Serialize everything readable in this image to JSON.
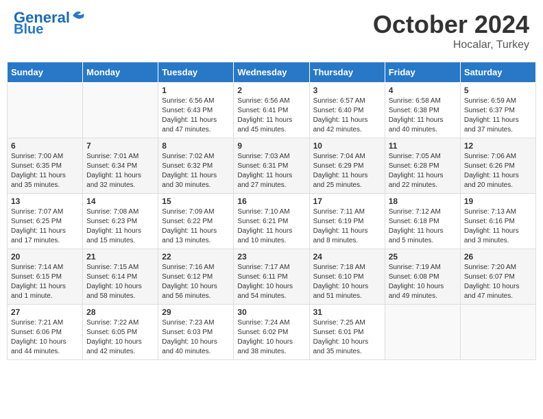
{
  "header": {
    "logo_line1": "General",
    "logo_line2": "Blue",
    "month": "October 2024",
    "location": "Hocalar, Turkey"
  },
  "days_of_week": [
    "Sunday",
    "Monday",
    "Tuesday",
    "Wednesday",
    "Thursday",
    "Friday",
    "Saturday"
  ],
  "weeks": [
    [
      {
        "day": "",
        "info": ""
      },
      {
        "day": "",
        "info": ""
      },
      {
        "day": "1",
        "info": "Sunrise: 6:56 AM\nSunset: 6:43 PM\nDaylight: 11 hours and 47 minutes."
      },
      {
        "day": "2",
        "info": "Sunrise: 6:56 AM\nSunset: 6:41 PM\nDaylight: 11 hours and 45 minutes."
      },
      {
        "day": "3",
        "info": "Sunrise: 6:57 AM\nSunset: 6:40 PM\nDaylight: 11 hours and 42 minutes."
      },
      {
        "day": "4",
        "info": "Sunrise: 6:58 AM\nSunset: 6:38 PM\nDaylight: 11 hours and 40 minutes."
      },
      {
        "day": "5",
        "info": "Sunrise: 6:59 AM\nSunset: 6:37 PM\nDaylight: 11 hours and 37 minutes."
      }
    ],
    [
      {
        "day": "6",
        "info": "Sunrise: 7:00 AM\nSunset: 6:35 PM\nDaylight: 11 hours and 35 minutes."
      },
      {
        "day": "7",
        "info": "Sunrise: 7:01 AM\nSunset: 6:34 PM\nDaylight: 11 hours and 32 minutes."
      },
      {
        "day": "8",
        "info": "Sunrise: 7:02 AM\nSunset: 6:32 PM\nDaylight: 11 hours and 30 minutes."
      },
      {
        "day": "9",
        "info": "Sunrise: 7:03 AM\nSunset: 6:31 PM\nDaylight: 11 hours and 27 minutes."
      },
      {
        "day": "10",
        "info": "Sunrise: 7:04 AM\nSunset: 6:29 PM\nDaylight: 11 hours and 25 minutes."
      },
      {
        "day": "11",
        "info": "Sunrise: 7:05 AM\nSunset: 6:28 PM\nDaylight: 11 hours and 22 minutes."
      },
      {
        "day": "12",
        "info": "Sunrise: 7:06 AM\nSunset: 6:26 PM\nDaylight: 11 hours and 20 minutes."
      }
    ],
    [
      {
        "day": "13",
        "info": "Sunrise: 7:07 AM\nSunset: 6:25 PM\nDaylight: 11 hours and 17 minutes."
      },
      {
        "day": "14",
        "info": "Sunrise: 7:08 AM\nSunset: 6:23 PM\nDaylight: 11 hours and 15 minutes."
      },
      {
        "day": "15",
        "info": "Sunrise: 7:09 AM\nSunset: 6:22 PM\nDaylight: 11 hours and 13 minutes."
      },
      {
        "day": "16",
        "info": "Sunrise: 7:10 AM\nSunset: 6:21 PM\nDaylight: 11 hours and 10 minutes."
      },
      {
        "day": "17",
        "info": "Sunrise: 7:11 AM\nSunset: 6:19 PM\nDaylight: 11 hours and 8 minutes."
      },
      {
        "day": "18",
        "info": "Sunrise: 7:12 AM\nSunset: 6:18 PM\nDaylight: 11 hours and 5 minutes."
      },
      {
        "day": "19",
        "info": "Sunrise: 7:13 AM\nSunset: 6:16 PM\nDaylight: 11 hours and 3 minutes."
      }
    ],
    [
      {
        "day": "20",
        "info": "Sunrise: 7:14 AM\nSunset: 6:15 PM\nDaylight: 11 hours and 1 minute."
      },
      {
        "day": "21",
        "info": "Sunrise: 7:15 AM\nSunset: 6:14 PM\nDaylight: 10 hours and 58 minutes."
      },
      {
        "day": "22",
        "info": "Sunrise: 7:16 AM\nSunset: 6:12 PM\nDaylight: 10 hours and 56 minutes."
      },
      {
        "day": "23",
        "info": "Sunrise: 7:17 AM\nSunset: 6:11 PM\nDaylight: 10 hours and 54 minutes."
      },
      {
        "day": "24",
        "info": "Sunrise: 7:18 AM\nSunset: 6:10 PM\nDaylight: 10 hours and 51 minutes."
      },
      {
        "day": "25",
        "info": "Sunrise: 7:19 AM\nSunset: 6:08 PM\nDaylight: 10 hours and 49 minutes."
      },
      {
        "day": "26",
        "info": "Sunrise: 7:20 AM\nSunset: 6:07 PM\nDaylight: 10 hours and 47 minutes."
      }
    ],
    [
      {
        "day": "27",
        "info": "Sunrise: 7:21 AM\nSunset: 6:06 PM\nDaylight: 10 hours and 44 minutes."
      },
      {
        "day": "28",
        "info": "Sunrise: 7:22 AM\nSunset: 6:05 PM\nDaylight: 10 hours and 42 minutes."
      },
      {
        "day": "29",
        "info": "Sunrise: 7:23 AM\nSunset: 6:03 PM\nDaylight: 10 hours and 40 minutes."
      },
      {
        "day": "30",
        "info": "Sunrise: 7:24 AM\nSunset: 6:02 PM\nDaylight: 10 hours and 38 minutes."
      },
      {
        "day": "31",
        "info": "Sunrise: 7:25 AM\nSunset: 6:01 PM\nDaylight: 10 hours and 35 minutes."
      },
      {
        "day": "",
        "info": ""
      },
      {
        "day": "",
        "info": ""
      }
    ]
  ]
}
